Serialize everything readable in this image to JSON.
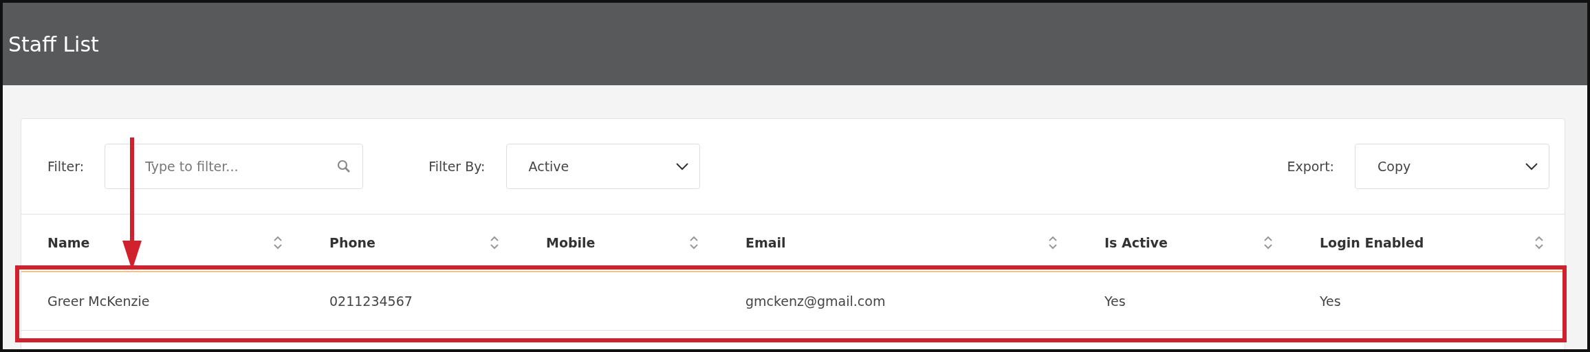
{
  "header": {
    "title": "Staff List"
  },
  "toolbar": {
    "filter": {
      "label": "Filter:",
      "placeholder": "Type to filter..."
    },
    "filter_by": {
      "label": "Filter By:",
      "value": "Active"
    },
    "export": {
      "label": "Export:",
      "value": "Copy"
    }
  },
  "table": {
    "columns": [
      {
        "label": "Name"
      },
      {
        "label": "Phone"
      },
      {
        "label": "Mobile"
      },
      {
        "label": "Email"
      },
      {
        "label": "Is Active"
      },
      {
        "label": "Login Enabled"
      }
    ],
    "rows": [
      {
        "cells": [
          "Greer McKenzie",
          "0211234567",
          null,
          "gmckenz@gmail.com",
          "Yes",
          "Yes"
        ]
      }
    ]
  },
  "annotations": {
    "arrow": true,
    "highlight_box": true
  }
}
